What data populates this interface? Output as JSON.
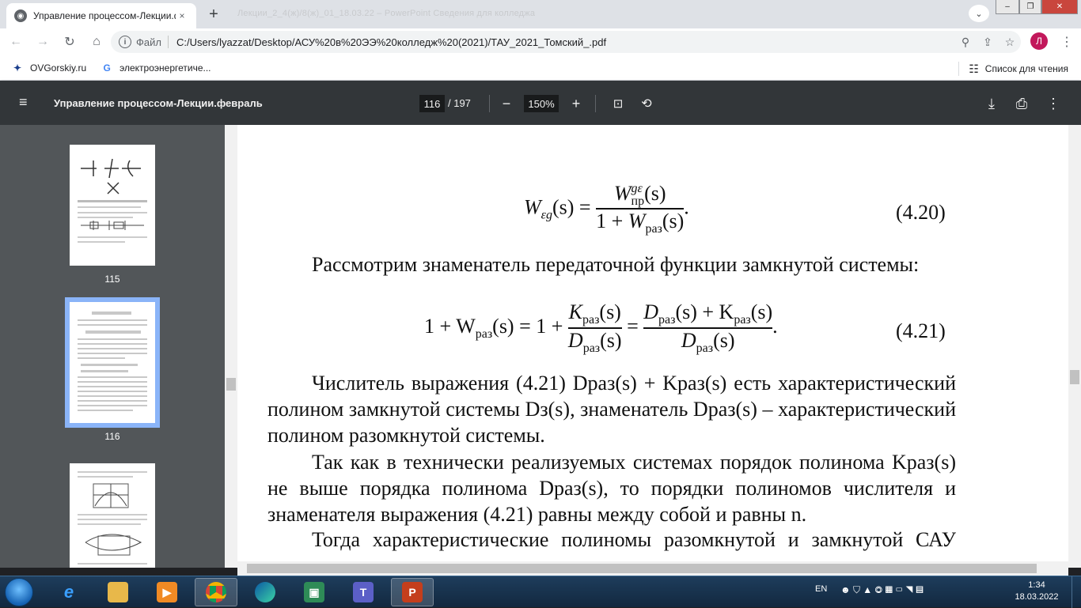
{
  "tab": {
    "title": "Управление процессом-Лекции.февраль",
    "close": "×"
  },
  "newtab": "+",
  "ghost_tabs": "Лекции_2_4(ж)/8(ж)_01_18.03.22 – PowerPoint                    Сведения для колледжа",
  "window": {
    "minimize": "–",
    "maximize": "❐",
    "close": "✕"
  },
  "nav": {
    "back": "←",
    "forward": "→",
    "reload": "↻",
    "home": "⌂"
  },
  "omnibox": {
    "scheme": "Файл",
    "url": "C:/Users/lyazzat/Desktop/АСУ%20в%20ЭЭ%20колледж%20(2021)/ТАУ_2021_Томский_.pdf",
    "zoom": "⚲",
    "share": "⇪",
    "star": "☆"
  },
  "profile": {
    "initial": "Л"
  },
  "bookmarks": [
    {
      "label": "OVGorskiy.ru",
      "icon": "ovg-icon"
    },
    {
      "label": "электроэнергетиче...",
      "icon": "google-icon"
    }
  ],
  "reading_list": "Список для чтения",
  "pdf": {
    "title": "Управление процессом-Лекции.февраль",
    "page": "116",
    "total": "/ 197",
    "zoom": "150%",
    "menu": "≡",
    "zoom_out": "−",
    "zoom_in": "+",
    "download": "⤓",
    "print": "⎙",
    "more": "⋮"
  },
  "thumbnails": [
    {
      "label": "115",
      "selected": false
    },
    {
      "label": "116",
      "selected": true
    },
    {
      "label": "",
      "selected": false
    }
  ],
  "page_content": {
    "eq420": {
      "lhs_W": "W",
      "lhs_sub": "εg",
      "lhs_arg": "(s) =",
      "num_W": "W",
      "num_sup": "gε",
      "num_sub": "пр",
      "num_arg": "(s)",
      "den_1": "1 + ",
      "den_W": "W",
      "den_sub": "раз",
      "den_arg": "(s)",
      "dot": ".",
      "number": "(4.20)"
    },
    "para1": "Рассмотрим знаменатель передаточной функции замкнутой системы:",
    "eq421": {
      "lhs": "1 + W",
      "lhs_sub": "раз",
      "lhs_arg": "(s) = 1 + ",
      "f1_num": "K",
      "f1_num_sub": "раз",
      "f1_num_arg": "(s)",
      "f1_den": "D",
      "f1_den_sub": "раз",
      "f1_den_arg": "(s)",
      "eq": " = ",
      "f2_num_a": "D",
      "f2_num_a_sub": "раз",
      "f2_num_b": "(s) + K",
      "f2_num_b_sub": "раз",
      "f2_num_c": "(s)",
      "f2_den": "D",
      "f2_den_sub": "раз",
      "f2_den_arg": "(s)",
      "dot": ".",
      "number": "(4.21)"
    },
    "para2": "Числитель выражения (4.21) Dраз(s) + Kраз(s) есть характеристический полином замкнутой системы Dз(s), знаменатель Dраз(s) – характеристический полином разомкнутой системы.",
    "para3": "Так как в технически реализуемых системах порядок полинома Kраз(s) не выше порядка полинома Dраз(s), то порядки полиномов числителя и знаменателя выражения (4.21) равны между собой и равны n.",
    "para4": "Тогда характеристические полиномы разомкнутой и замкнутой САУ соответствуют следующим выражениям:"
  },
  "taskbar": {
    "apps": [
      "explorer",
      "media",
      "chrome",
      "edge",
      "store",
      "teams",
      "powerpoint"
    ],
    "lang": "EN",
    "time": "1:34",
    "date": "18.03.2022"
  }
}
